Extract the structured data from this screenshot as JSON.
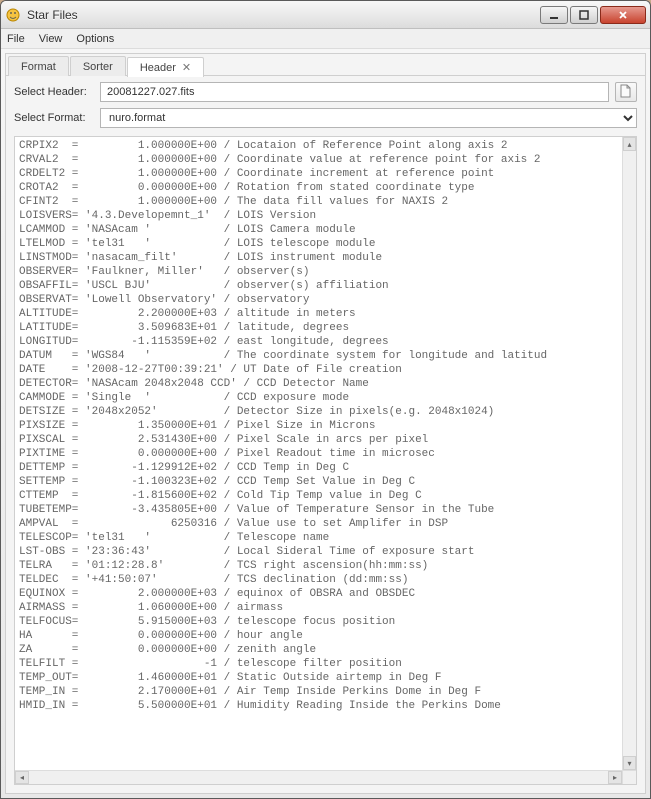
{
  "window": {
    "title": "Star Files"
  },
  "menu": {
    "items": [
      "File",
      "View",
      "Options"
    ]
  },
  "tabs": [
    {
      "label": "Format",
      "active": false,
      "closable": false
    },
    {
      "label": "Sorter",
      "active": false,
      "closable": false
    },
    {
      "label": "Header",
      "active": true,
      "closable": true
    }
  ],
  "form": {
    "select_header_label": "Select Header:",
    "select_header_value": "20081227.027.fits",
    "select_format_label": "Select Format:",
    "select_format_value": "nuro.format"
  },
  "header_lines": [
    "CRPIX2  =         1.000000E+00 / Locataion of Reference Point along axis 2",
    "CRVAL2  =         1.000000E+00 / Coordinate value at reference point for axis 2",
    "CRDELT2 =         1.000000E+00 / Coordinate increment at reference point",
    "CROTA2  =         0.000000E+00 / Rotation from stated coordinate type",
    "CFINT2  =         1.000000E+00 / The data fill values for NAXIS 2",
    "LOISVERS= '4.3.Developemnt_1'  / LOIS Version",
    "LCAMMOD = 'NASAcam '           / LOIS Camera module",
    "LTELMOD = 'tel31   '           / LOIS telescope module",
    "LINSTMOD= 'nasacam_filt'       / LOIS instrument module",
    "OBSERVER= 'Faulkner, Miller'   / observer(s)",
    "OBSAFFIL= 'USCL BJU'           / observer(s) affiliation",
    "OBSERVAT= 'Lowell Observatory' / observatory",
    "ALTITUDE=         2.200000E+03 / altitude in meters",
    "LATITUDE=         3.509683E+01 / latitude, degrees",
    "LONGITUD=        -1.115359E+02 / east longitude, degrees",
    "DATUM   = 'WGS84   '           / The coordinate system for longitude and latitud",
    "DATE    = '2008-12-27T00:39:21' / UT Date of File creation",
    "DETECTOR= 'NASAcam 2048x2048 CCD' / CCD Detector Name",
    "CAMMODE = 'Single  '           / CCD exposure mode",
    "DETSIZE = '2048x2052'          / Detector Size in pixels(e.g. 2048x1024)",
    "PIXSIZE =         1.350000E+01 / Pixel Size in Microns",
    "PIXSCAL =         2.531430E+00 / Pixel Scale in arcs per pixel",
    "PIXTIME =         0.000000E+00 / Pixel Readout time in microsec",
    "DETTEMP =        -1.129912E+02 / CCD Temp in Deg C",
    "SETTEMP =        -1.100323E+02 / CCD Temp Set Value in Deg C",
    "CTTEMP  =        -1.815600E+02 / Cold Tip Temp value in Deg C",
    "TUBETEMP=        -3.435805E+00 / Value of Temperature Sensor in the Tube",
    "AMPVAL  =              6250316 / Value use to set Amplifer in DSP",
    "TELESCOP= 'tel31   '           / Telescope name",
    "LST-OBS = '23:36:43'           / Local Sideral Time of exposure start",
    "TELRA   = '01:12:28.8'         / TCS right ascension(hh:mm:ss)",
    "TELDEC  = '+41:50:07'          / TCS declination (dd:mm:ss)",
    "EQUINOX =         2.000000E+03 / equinox of OBSRA and OBSDEC",
    "AIRMASS =         1.060000E+00 / airmass",
    "TELFOCUS=         5.915000E+03 / telescope focus position",
    "HA      =         0.000000E+00 / hour angle",
    "ZA      =         0.000000E+00 / zenith angle",
    "TELFILT =                   -1 / telescope filter position",
    "TEMP_OUT=         1.460000E+01 / Static Outside airtemp in Deg F",
    "TEMP_IN =         2.170000E+01 / Air Temp Inside Perkins Dome in Deg F",
    "HMID_IN =         5.500000E+01 / Humidity Reading Inside the Perkins Dome"
  ]
}
